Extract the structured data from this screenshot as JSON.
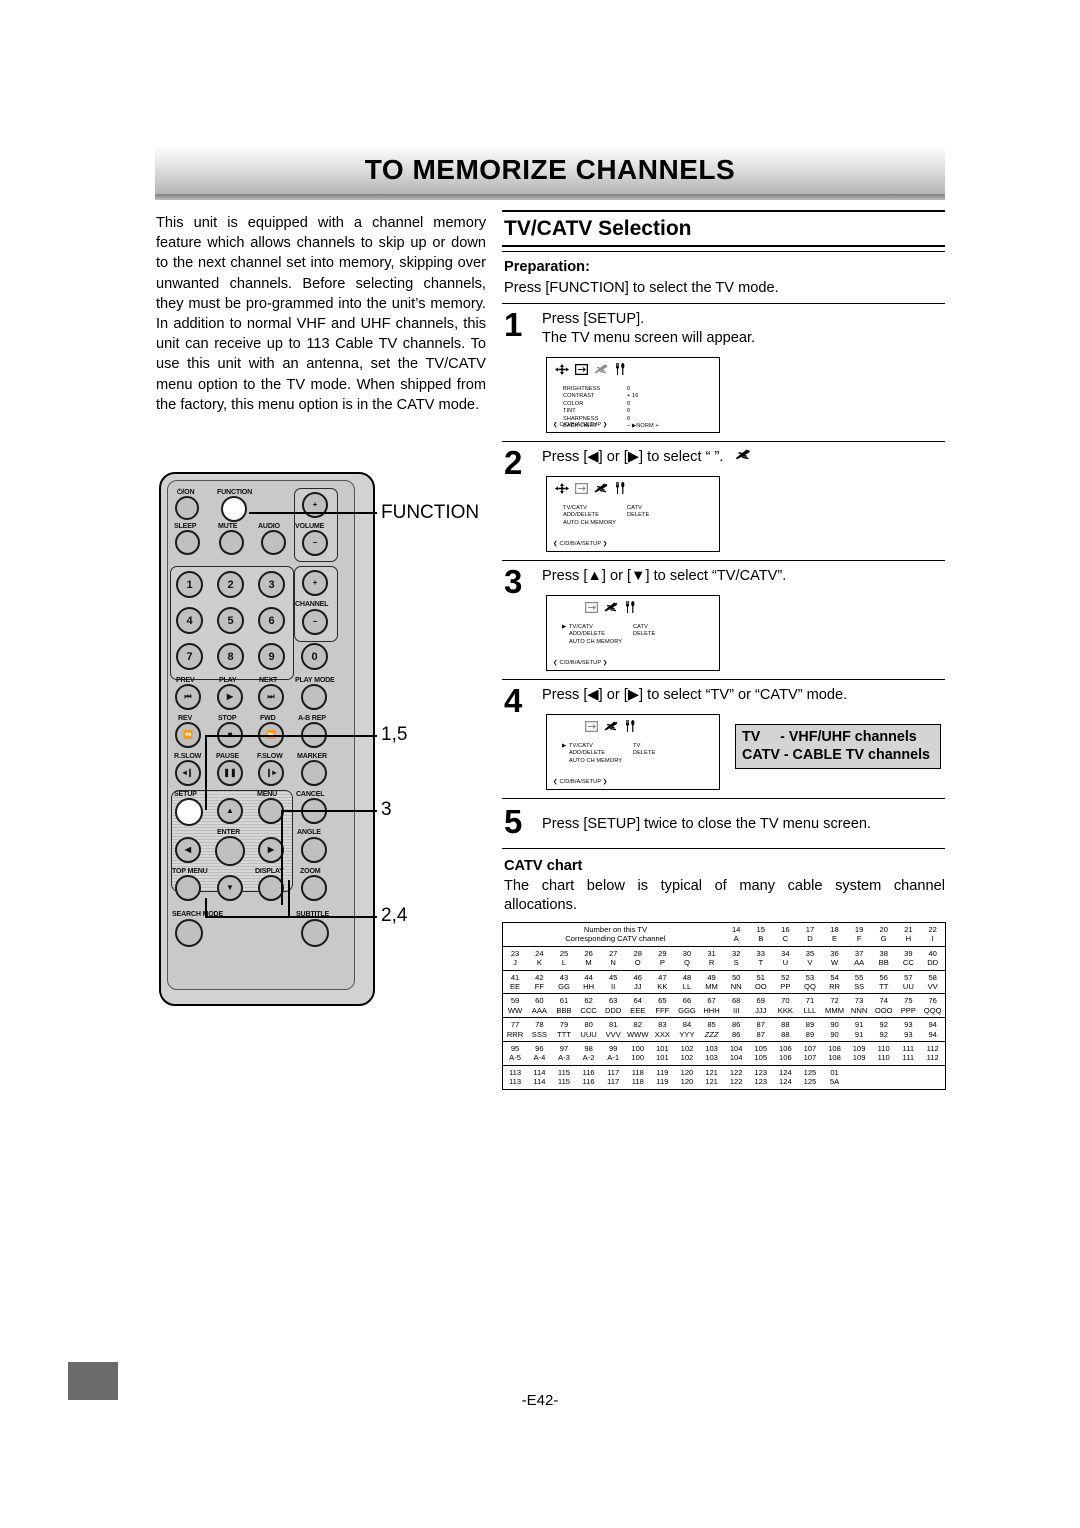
{
  "banner": {
    "title": "TO MEMORIZE CHANNELS"
  },
  "intro": {
    "text": "This unit is equipped with a channel memory feature which allows channels to skip up or down to the next channel set into memory, skipping over unwanted channels. Before selecting channels, they must be pro-grammed into the unit’s memory. In addition to normal VHF and UHF channels, this unit can receive up to 113 Cable TV channels. To use this unit with an antenna, set the TV/CATV menu option to the TV mode. When shipped from the factory, this menu option is in the CATV mode."
  },
  "remote": {
    "buttons": {
      "power": "⏻/ON",
      "function": "FUNCTION",
      "sleep": "SLEEP",
      "mute": "MUTE",
      "audio": "AUDIO",
      "volume": "VOLUME",
      "volume_plus": "+",
      "volume_minus": "−",
      "channel": "CHANNEL",
      "channel_plus": "+",
      "channel_minus": "−",
      "n1": "1",
      "n2": "2",
      "n3": "3",
      "n4": "4",
      "n5": "5",
      "n6": "6",
      "n7": "7",
      "n8": "8",
      "n9": "9",
      "n0": "0",
      "prev": "PREV",
      "play": "PLAY",
      "next": "NEXT",
      "play_mode": "PLAY MODE",
      "rev": "REV",
      "stop": "STOP",
      "fwd": "FWD",
      "ab_rep": "A-B REP",
      "r_slow": "R.SLOW",
      "pause": "PAUSE",
      "f_slow": "F.SLOW",
      "marker": "MARKER",
      "setup": "SETUP",
      "menu": "MENU",
      "cancel": "CANCEL",
      "enter": "ENTER",
      "angle": "ANGLE",
      "top_menu": "TOP MENU",
      "display": "DISPLAY",
      "zoom": "ZOOM",
      "search_mode": "SEARCH MODE",
      "subtitle": "SUBTITLE"
    },
    "callouts": [
      {
        "label": "FUNCTION"
      },
      {
        "label": "1,5"
      },
      {
        "label": "3"
      },
      {
        "label": "2,4"
      }
    ]
  },
  "section": {
    "title": "TV/CATV Selection",
    "preparation_label": "Preparation:",
    "preparation_text": "Press [FUNCTION] to select the TV mode."
  },
  "steps": [
    {
      "num": "1",
      "line1": "Press [SETUP].",
      "line2": "The TV menu screen will appear.",
      "osd": {
        "icons": [
          "arrows-icon",
          "picture-icon",
          "antenna-icon",
          "tools-icon"
        ],
        "rows": [
          {
            "key": "BRIGHTNESS",
            "value": "0"
          },
          {
            "key": "CONTRAST",
            "value": "+ 16"
          },
          {
            "key": "COLOR",
            "value": "0"
          },
          {
            "key": "TINT",
            "value": "0"
          },
          {
            "key": "SHARPNESS",
            "value": "0"
          },
          {
            "key": "BACK LIGHT",
            "value": "– ▶NORM +"
          }
        ],
        "footer": "❮ C/D/B/A/SETUP ❯"
      }
    },
    {
      "num": "2",
      "line1": "Press [◀] or [▶] to select “ ”.",
      "line2": "",
      "osd": {
        "icons": [
          "arrows-icon",
          "picture-icon",
          "antenna-icon",
          "tools-icon"
        ],
        "rows": [
          {
            "key": "TV/CATV",
            "value": "CATV"
          },
          {
            "key": "ADD/DELETE",
            "value": "DELETE"
          },
          {
            "key": "AUTO CH MEMORY",
            "value": ""
          }
        ],
        "footer": "❮ C/D/B/A/SETUP ❯"
      }
    },
    {
      "num": "3",
      "line1": "Press [▲] or [▼] to select “TV/CATV”.",
      "line2": "",
      "osd": {
        "icons": [
          "picture-icon",
          "antenna-icon",
          "tools-icon"
        ],
        "rows": [
          {
            "key": "TV/CATV",
            "value": "CATV",
            "cursor": true
          },
          {
            "key": "ADD/DELETE",
            "value": "DELETE"
          },
          {
            "key": "AUTO CH MEMORY",
            "value": ""
          }
        ],
        "footer": "❮ C/D/B/A/SETUP ❯"
      }
    },
    {
      "num": "4",
      "line1": "Press [◀] or [▶] to select “TV” or “CATV” mode.",
      "line2": "",
      "osd": {
        "icons": [
          "picture-icon",
          "antenna-icon",
          "tools-icon"
        ],
        "rows": [
          {
            "key": "TV/CATV",
            "value": "TV",
            "cursor": true
          },
          {
            "key": "ADD/DELETE",
            "value": "DELETE"
          },
          {
            "key": "AUTO CH MEMORY",
            "value": ""
          }
        ],
        "footer": "❮ C/D/B/A/SETUP ❯"
      },
      "note_line1": "TV     - VHF/UHF channels",
      "note_line2": "CATV - CABLE TV channels"
    },
    {
      "num": "5",
      "line1": "Press [SETUP] twice to close the TV menu screen.",
      "line2": ""
    }
  ],
  "catv": {
    "heading": "CATV chart",
    "intro": "The chart below is typical of many cable system channel allocations.",
    "row_label_1": "Number on this TV",
    "row_label_2": "Corresponding CATV channel",
    "chart_data": {
      "type": "table",
      "title": "CATV chart",
      "row_labels": [
        "Number on this TV",
        "Corresponding CATV channel"
      ],
      "blocks": [
        {
          "tv": [
            "",
            "",
            "",
            "",
            "",
            "",
            "",
            "",
            "",
            "14",
            "15",
            "16",
            "17",
            "18",
            "19",
            "20",
            "21",
            "22"
          ],
          "catv": [
            "",
            "",
            "",
            "",
            "",
            "",
            "",
            "",
            "",
            "A",
            "B",
            "C",
            "D",
            "E",
            "F",
            "G",
            "H",
            "I"
          ],
          "labeled": true
        },
        {
          "tv": [
            "23",
            "24",
            "25",
            "26",
            "27",
            "28",
            "29",
            "30",
            "31",
            "32",
            "33",
            "34",
            "35",
            "36",
            "37",
            "38",
            "39",
            "40"
          ],
          "catv": [
            "J",
            "K",
            "L",
            "M",
            "N",
            "O",
            "P",
            "Q",
            "R",
            "S",
            "T",
            "U",
            "V",
            "W",
            "AA",
            "BB",
            "CC",
            "DD"
          ]
        },
        {
          "tv": [
            "41",
            "42",
            "43",
            "44",
            "45",
            "46",
            "47",
            "48",
            "49",
            "50",
            "51",
            "52",
            "53",
            "54",
            "55",
            "56",
            "57",
            "58"
          ],
          "catv": [
            "EE",
            "FF",
            "GG",
            "HH",
            "II",
            "JJ",
            "KK",
            "LL",
            "MM",
            "NN",
            "OO",
            "PP",
            "QQ",
            "RR",
            "SS",
            "TT",
            "UU",
            "VV"
          ]
        },
        {
          "tv": [
            "59",
            "60",
            "61",
            "62",
            "63",
            "64",
            "65",
            "66",
            "67",
            "68",
            "69",
            "70",
            "71",
            "72",
            "73",
            "74",
            "75",
            "76"
          ],
          "catv": [
            "WW",
            "AAA",
            "BBB",
            "CCC",
            "DDD",
            "EEE",
            "FFF",
            "GGG",
            "HHH",
            "III",
            "JJJ",
            "KKK",
            "LLL",
            "MMM",
            "NNN",
            "OOO",
            "PPP",
            "QQQ"
          ]
        },
        {
          "tv": [
            "77",
            "78",
            "79",
            "80",
            "81",
            "82",
            "83",
            "84",
            "85",
            "86",
            "87",
            "88",
            "89",
            "90",
            "91",
            "92",
            "93",
            "94"
          ],
          "catv": [
            "RRR",
            "SSS",
            "TTT",
            "UUU",
            "VVV",
            "WWW",
            "XXX",
            "YYY",
            "ZZZ",
            "86",
            "87",
            "88",
            "89",
            "90",
            "91",
            "92",
            "93",
            "94"
          ]
        },
        {
          "tv": [
            "95",
            "96",
            "97",
            "98",
            "99",
            "100",
            "101",
            "102",
            "103",
            "104",
            "105",
            "106",
            "107",
            "108",
            "109",
            "110",
            "111",
            "112"
          ],
          "catv": [
            "A-5",
            "A-4",
            "A-3",
            "A-2",
            "A-1",
            "100",
            "101",
            "102",
            "103",
            "104",
            "105",
            "106",
            "107",
            "108",
            "109",
            "110",
            "111",
            "112"
          ]
        },
        {
          "tv": [
            "113",
            "114",
            "115",
            "116",
            "117",
            "118",
            "119",
            "120",
            "121",
            "122",
            "123",
            "124",
            "125",
            "01",
            "",
            "",
            "",
            ""
          ],
          "catv": [
            "113",
            "114",
            "115",
            "116",
            "117",
            "118",
            "119",
            "120",
            "121",
            "122",
            "123",
            "124",
            "125",
            "5A",
            "",
            "",
            "",
            ""
          ]
        }
      ]
    }
  },
  "footer": {
    "page": "-E42-"
  }
}
